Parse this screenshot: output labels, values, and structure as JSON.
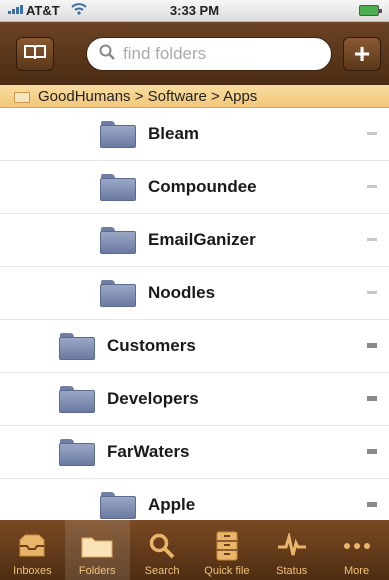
{
  "status_bar": {
    "carrier": "AT&T",
    "time": "3:33 PM"
  },
  "navbar": {
    "search_placeholder": "find folders"
  },
  "breadcrumb": {
    "path": "GoodHumans > Software > Apps"
  },
  "folders": [
    {
      "label": "Bleam",
      "level": 1
    },
    {
      "label": "Compoundee",
      "level": 1
    },
    {
      "label": "EmailGanizer",
      "level": 1
    },
    {
      "label": "Noodles",
      "level": 1
    },
    {
      "label": "Customers",
      "level": 0
    },
    {
      "label": "Developers",
      "level": 0
    },
    {
      "label": "FarWaters",
      "level": 0
    },
    {
      "label": "Apple",
      "level": 1
    }
  ],
  "tabbar": {
    "items": [
      {
        "label": "Inboxes",
        "icon": "inbox-icon"
      },
      {
        "label": "Folders",
        "icon": "folder-icon",
        "active": true
      },
      {
        "label": "Search",
        "icon": "search-icon"
      },
      {
        "label": "Quick file",
        "icon": "cabinet-icon"
      },
      {
        "label": "Status",
        "icon": "pulse-icon"
      },
      {
        "label": "More",
        "icon": "more-icon"
      }
    ]
  },
  "colors": {
    "navbar": "#5b3719",
    "breadcrumb": "#f4cf86",
    "tab_label": "#f0c27c"
  }
}
